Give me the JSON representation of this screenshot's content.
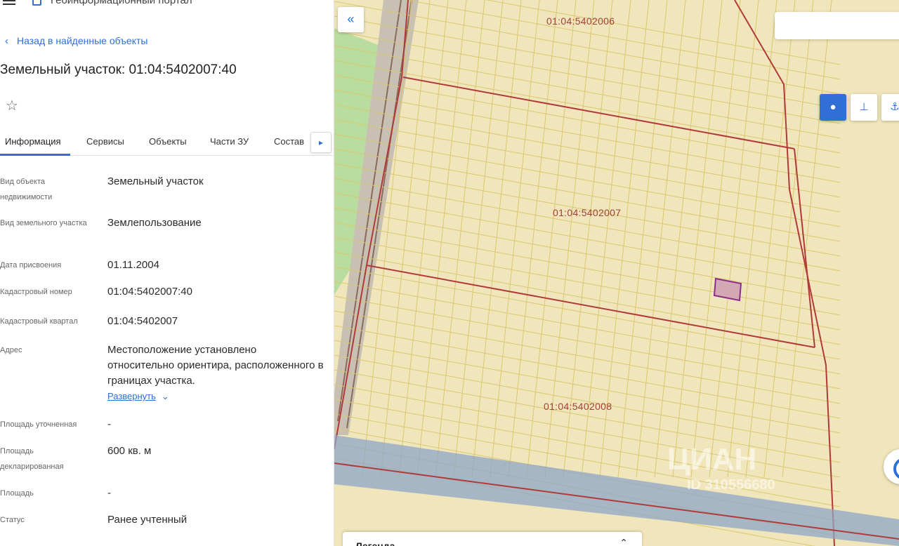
{
  "header": {
    "portal_title": "Геоинформационный портал"
  },
  "nav": {
    "back_label": "Назад в найденные объекты"
  },
  "object": {
    "title": "Земельный участок: 01:04:5402007:40"
  },
  "tabs": [
    {
      "label": "Информация",
      "active": true
    },
    {
      "label": "Сервисы"
    },
    {
      "label": "Объекты"
    },
    {
      "label": "Части ЗУ"
    },
    {
      "label": "Состав"
    }
  ],
  "properties": [
    {
      "label": "Вид объекта недвижимости",
      "value": "Земельный участок"
    },
    {
      "label": "Вид земельного участка",
      "value": "Землепользование"
    },
    {
      "label": "Дата присвоения",
      "value": "01.11.2004"
    },
    {
      "label": "Кадастровый номер",
      "value": "01:04:5402007:40"
    },
    {
      "label": "Кадастровый квартал",
      "value": "01:04:5402007"
    },
    {
      "label": "Адрес",
      "value": "Местоположение установлено относительно ориентира, расположенного в границах участка."
    },
    {
      "label": "Площадь уточненная",
      "value": "-"
    },
    {
      "label": "Площадь декларированная",
      "value": "600 кв. м"
    },
    {
      "label": "Площадь",
      "value": "-"
    },
    {
      "label": "Статус",
      "value": "Ранее учтенный"
    }
  ],
  "expand_label": "Развернуть",
  "map": {
    "quarters": [
      "01:04:5402006",
      "01:04:5402007",
      "01:04:5402008"
    ],
    "legend_label": "Легенда",
    "watermark": "ЦИАН",
    "watermark_id": "ID 310556680",
    "colors": {
      "parcel_fill": "#f1e6bb",
      "parcel_line": "#d9c870",
      "quarter_border": "#b03a3a",
      "selected": "#8a2f8a",
      "accent": "#2f6fd6"
    }
  },
  "icons": [
    "menu-icon",
    "portal-logo-icon",
    "chevron-left-icon",
    "star-icon",
    "chevron-right-icon",
    "double-chevron-left-icon",
    "point-tool-icon",
    "ruler-tool-icon",
    "boat-tool-icon",
    "chevron-up-icon",
    "locate-icon"
  ]
}
